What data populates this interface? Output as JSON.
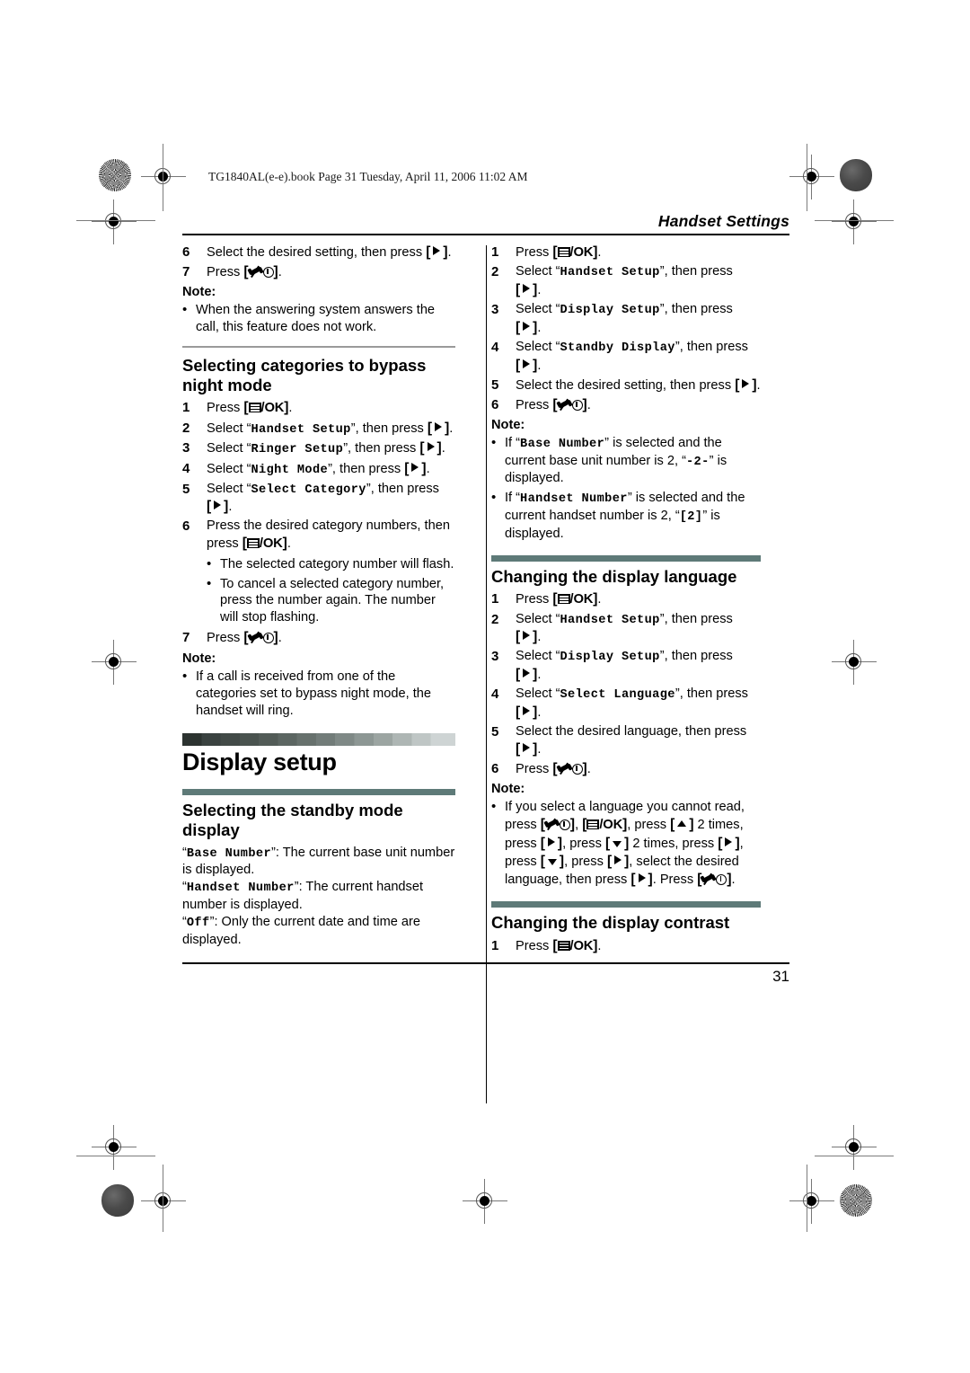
{
  "book_line": "TG1840AL(e-e).book  Page 31  Tuesday, April 11, 2006  11:02 AM",
  "running_head": "Handset Settings",
  "folio": "31",
  "colors": {
    "teal_bar": "#5e7a78",
    "gradient_dark": "#2c3330",
    "gradient_light": "#ced4d4",
    "rule": "#000000",
    "thin_rule": "#9a9a9a"
  },
  "keys": {
    "menu_ok": "[Menu/OK]",
    "right": "[Right]",
    "up": "[Up]",
    "down": "[Down]",
    "offhook": "[Off/Power]"
  },
  "left_column": {
    "continued_steps": [
      {
        "num": "6",
        "text_before": "Select the desired setting, then press",
        "key": "right",
        "text_after": "."
      },
      {
        "num": "7",
        "text_before": "Press",
        "key": "offhook",
        "text_after": "."
      }
    ],
    "note_1": {
      "label": "Note:",
      "bullets": [
        "When the answering system answers the call, this feature does not work."
      ]
    },
    "subsection_1": {
      "title": "Selecting categories to bypass night mode",
      "steps": [
        {
          "num": "1",
          "text": "Press [Menu/OK]."
        },
        {
          "num": "2",
          "text": "Select “Handset Setup”, then press [Right].",
          "lcd": "Handset Setup"
        },
        {
          "num": "3",
          "text": "Select “Ringer Setup”, then press [Right].",
          "lcd": "Ringer Setup"
        },
        {
          "num": "4",
          "text": "Select “Night Mode”, then press [Right].",
          "lcd": "Night Mode"
        },
        {
          "num": "5",
          "text": "Select “Select Category”, then press [Right].",
          "lcd": "Select Category"
        },
        {
          "num": "6",
          "text": "Press the desired category numbers, then press [Menu/OK]."
        },
        {
          "num": "7",
          "text": "Press [Off/Power]."
        }
      ],
      "step6_bullets": [
        "The selected category number will flash.",
        "To cancel a selected category number, press the number again. The number will stop flashing."
      ]
    },
    "note_2": {
      "label": "Note:",
      "bullets": [
        "If a call is received from one of the categories set to bypass night mode, the handset will ring."
      ]
    },
    "section": {
      "title": "Display setup"
    },
    "subsection_2": {
      "title": "Selecting the standby mode display",
      "definitions": [
        {
          "term": "Base Number",
          "desc": ": The current base unit number is displayed."
        },
        {
          "term": "Handset Number",
          "desc": ": The current handset number is displayed."
        },
        {
          "term": "Off",
          "desc": ": Only the current date and time are displayed."
        }
      ]
    }
  },
  "right_column": {
    "steps_standby": [
      {
        "num": "1",
        "text": "Press [Menu/OK]."
      },
      {
        "num": "2",
        "lcd": "Handset Setup"
      },
      {
        "num": "3",
        "lcd": "Display Setup"
      },
      {
        "num": "4",
        "lcd": "Standby Display"
      },
      {
        "num": "5",
        "text": "Select the desired setting, then press [Right]."
      },
      {
        "num": "6",
        "text": "Press [Off/Power]."
      }
    ],
    "note_1": {
      "label": "Note:",
      "bullets": [
        {
          "lcd1": "Base Number",
          "lcd2": "-2-",
          "text_a": "If “",
          "text_b": "” is selected and the current base unit number is 2, “",
          "text_c": "” is displayed."
        },
        {
          "lcd1": "Handset Number",
          "lcd2": "[2]",
          "text_a": "If “",
          "text_b": "” is selected and the current handset number is 2, “",
          "text_c": "” is displayed."
        }
      ]
    },
    "subsection_language": {
      "title": "Changing the display language",
      "steps": [
        {
          "num": "1",
          "text": "Press [Menu/OK]."
        },
        {
          "num": "2",
          "lcd": "Handset Setup"
        },
        {
          "num": "3",
          "lcd": "Display Setup"
        },
        {
          "num": "4",
          "lcd": "Select Language"
        },
        {
          "num": "5",
          "text": "Select the desired language, then press [Right]."
        },
        {
          "num": "6",
          "text": "Press [Off/Power]."
        }
      ]
    },
    "note_language": {
      "label": "Note:",
      "bullet_parts": {
        "p1": "If you select a language you cannot read, press",
        "p2": ",",
        "p3": ", press",
        "p4": "2 times, press",
        "p5": ", press",
        "p6": "2 times, press",
        "p7": ", press",
        "p8": ", press",
        "p9": ", select the desired language, then press",
        "p10": ". Press",
        "p11": "."
      }
    },
    "subsection_contrast": {
      "title": "Changing the display contrast",
      "steps": [
        {
          "num": "1",
          "text": "Press [Menu/OK]."
        }
      ]
    }
  },
  "labels": {
    "select_prefix": "Select “",
    "then_press_suffix": "”, then press",
    "then_suffix": "”, then",
    "press_word": "press",
    "period": "."
  }
}
